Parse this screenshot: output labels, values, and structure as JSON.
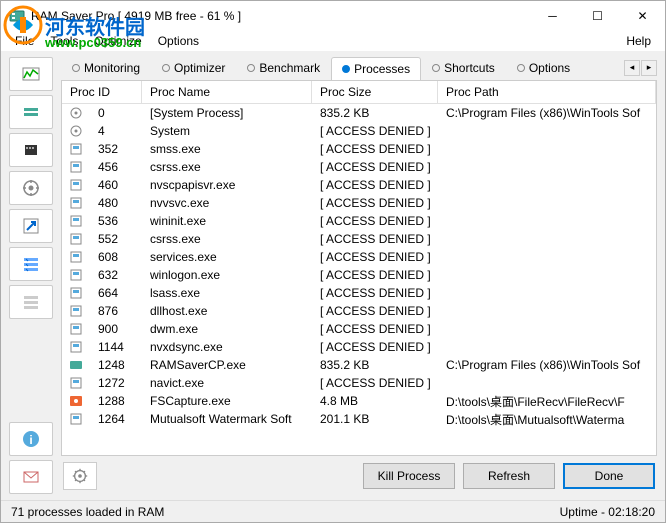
{
  "title": "RAM Saver Pro [ 4919 MB free - 61 % ]",
  "menu": {
    "file": "File",
    "tools": "Tools",
    "optimize": "Optimize",
    "options": "Options",
    "help": "Help"
  },
  "watermark": {
    "text1": "河东软件园",
    "text2": "www.pc0359.cn"
  },
  "tabs": {
    "monitoring": "Monitoring",
    "optimizer": "Optimizer",
    "benchmark": "Benchmark",
    "processes": "Processes",
    "shortcuts": "Shortcuts",
    "options": "Options"
  },
  "columns": {
    "id": "Proc ID",
    "name": "Proc Name",
    "size": "Proc Size",
    "path": "Proc Path"
  },
  "rows": [
    {
      "id": "0",
      "name": "[System Process]",
      "size": "835.2 KB",
      "path": "C:\\Program Files (x86)\\WinTools Sof",
      "icon": "gear"
    },
    {
      "id": "4",
      "name": "System",
      "size": "[ ACCESS DENIED ]",
      "path": "",
      "icon": "gear"
    },
    {
      "id": "352",
      "name": "smss.exe",
      "size": "[ ACCESS DENIED ]",
      "path": "",
      "icon": "app"
    },
    {
      "id": "456",
      "name": "csrss.exe",
      "size": "[ ACCESS DENIED ]",
      "path": "",
      "icon": "app"
    },
    {
      "id": "460",
      "name": "nvscpapisvr.exe",
      "size": "[ ACCESS DENIED ]",
      "path": "",
      "icon": "app"
    },
    {
      "id": "480",
      "name": "nvvsvc.exe",
      "size": "[ ACCESS DENIED ]",
      "path": "",
      "icon": "app"
    },
    {
      "id": "536",
      "name": "wininit.exe",
      "size": "[ ACCESS DENIED ]",
      "path": "",
      "icon": "app"
    },
    {
      "id": "552",
      "name": "csrss.exe",
      "size": "[ ACCESS DENIED ]",
      "path": "",
      "icon": "app"
    },
    {
      "id": "608",
      "name": "services.exe",
      "size": "[ ACCESS DENIED ]",
      "path": "",
      "icon": "app"
    },
    {
      "id": "632",
      "name": "winlogon.exe",
      "size": "[ ACCESS DENIED ]",
      "path": "",
      "icon": "app"
    },
    {
      "id": "664",
      "name": "lsass.exe",
      "size": "[ ACCESS DENIED ]",
      "path": "",
      "icon": "app"
    },
    {
      "id": "876",
      "name": "dllhost.exe",
      "size": "[ ACCESS DENIED ]",
      "path": "",
      "icon": "app"
    },
    {
      "id": "900",
      "name": "dwm.exe",
      "size": "[ ACCESS DENIED ]",
      "path": "",
      "icon": "app"
    },
    {
      "id": "1144",
      "name": "nvxdsync.exe",
      "size": "[ ACCESS DENIED ]",
      "path": "",
      "icon": "app"
    },
    {
      "id": "1248",
      "name": "RAMSaverCP.exe",
      "size": "835.2 KB",
      "path": "C:\\Program Files (x86)\\WinTools Sof",
      "icon": "ram"
    },
    {
      "id": "1272",
      "name": "navict.exe",
      "size": "[ ACCESS DENIED ]",
      "path": "",
      "icon": "app"
    },
    {
      "id": "1288",
      "name": "FSCapture.exe",
      "size": "4.8 MB",
      "path": "D:\\tools\\桌面\\FileRecv\\FileRecv\\F",
      "icon": "fs"
    },
    {
      "id": "1264",
      "name": "Mutualsoft Watermark Soft",
      "size": "201.1 KB",
      "path": "D:\\tools\\桌面\\Mutualsoft\\Waterma",
      "icon": "app"
    }
  ],
  "buttons": {
    "kill": "Kill Process",
    "refresh": "Refresh",
    "done": "Done"
  },
  "status": {
    "left": "71 processes loaded in RAM",
    "right": "Uptime - 02:18:20"
  }
}
